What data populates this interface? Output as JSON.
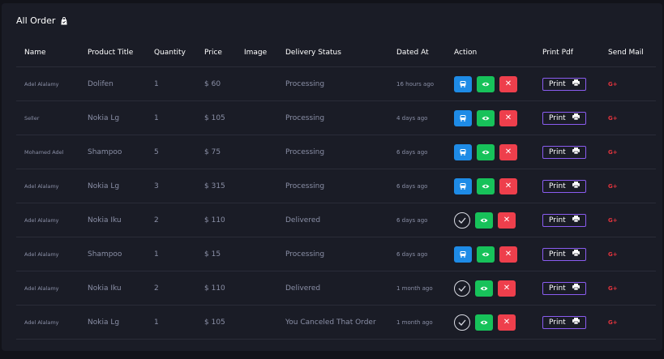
{
  "title": "All Order",
  "columns": [
    "Name",
    "Product Title",
    "Quantity",
    "Price",
    "Image",
    "Delivery Status",
    "Dated At",
    "Action",
    "Print Pdf",
    "Send Mail"
  ],
  "print_label": "Print",
  "mail_label": "G+",
  "rows": [
    {
      "name": "Adel Alalamy",
      "product": "Dolifen",
      "qty": "1",
      "price": "$ 60",
      "status": "Processing",
      "date": "16 hours ago",
      "first_action": "deliver"
    },
    {
      "name": "Seller",
      "product": "Nokia Lg",
      "qty": "1",
      "price": "$ 105",
      "status": "Processing",
      "date": "4 days ago",
      "first_action": "deliver"
    },
    {
      "name": "Mohamed Adel",
      "product": "Shampoo",
      "qty": "5",
      "price": "$ 75",
      "status": "Processing",
      "date": "6 days ago",
      "first_action": "deliver"
    },
    {
      "name": "Adel Alalamy",
      "product": "Nokia Lg",
      "qty": "3",
      "price": "$ 315",
      "status": "Processing",
      "date": "6 days ago",
      "first_action": "deliver"
    },
    {
      "name": "Adel Alalamy",
      "product": "Nokia Iku",
      "qty": "2",
      "price": "$ 110",
      "status": "Delivered",
      "date": "6 days ago",
      "first_action": "done"
    },
    {
      "name": "Adel Alalamy",
      "product": "Shampoo",
      "qty": "1",
      "price": "$ 15",
      "status": "Processing",
      "date": "6 days ago",
      "first_action": "deliver"
    },
    {
      "name": "Adel Alalamy",
      "product": "Nokia Iku",
      "qty": "2",
      "price": "$ 110",
      "status": "Delivered",
      "date": "1 month ago",
      "first_action": "done"
    },
    {
      "name": "Adel Alalamy",
      "product": "Nokia Lg",
      "qty": "1",
      "price": "$ 105",
      "status": "You Canceled That Order",
      "date": "1 month ago",
      "first_action": "done"
    }
  ]
}
